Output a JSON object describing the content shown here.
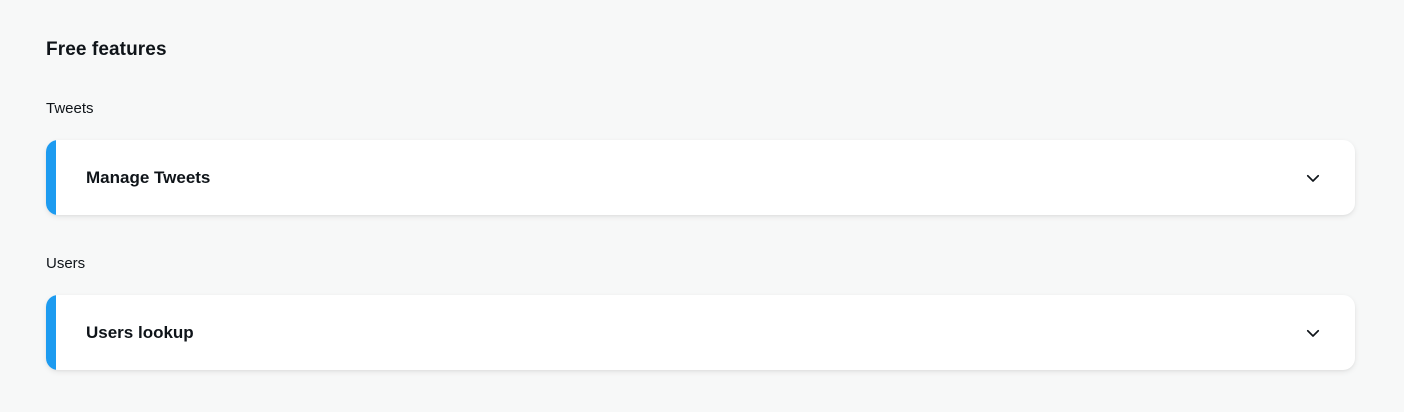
{
  "page": {
    "title": "Free features"
  },
  "sections": [
    {
      "label": "Tweets",
      "accordion": {
        "title": "Manage Tweets",
        "icon": "chevron-down-icon",
        "expanded": false
      }
    },
    {
      "label": "Users",
      "accordion": {
        "title": "Users lookup",
        "icon": "chevron-down-icon",
        "expanded": false
      }
    }
  ],
  "colors": {
    "accent": "#1d9bf0",
    "background": "#f7f8f8",
    "card": "#ffffff",
    "text": "#0f1419"
  }
}
